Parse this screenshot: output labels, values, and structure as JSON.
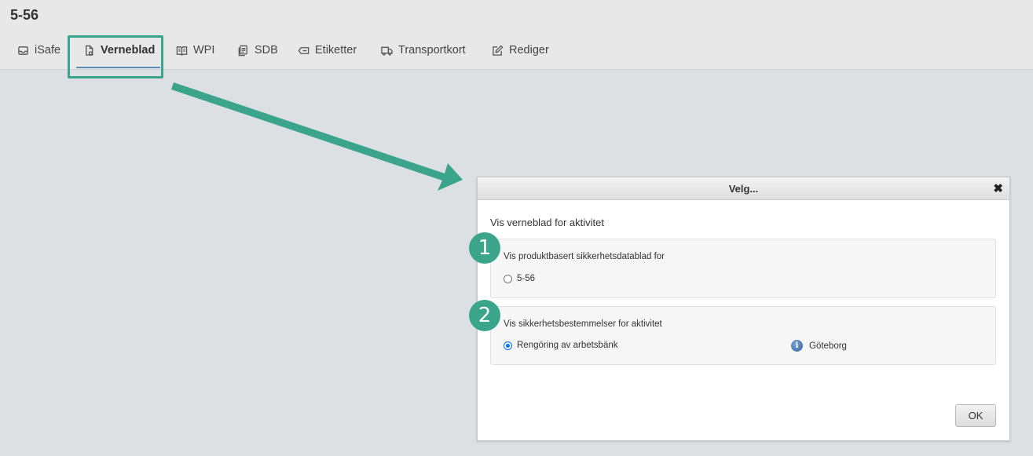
{
  "page": {
    "title": "5-56"
  },
  "tabs": [
    {
      "label": "iSafe",
      "icon": "inbox-icon",
      "active": false
    },
    {
      "label": "Verneblad",
      "icon": "document-shield-icon",
      "active": true
    },
    {
      "label": "WPI",
      "icon": "book-icon",
      "active": false
    },
    {
      "label": "SDB",
      "icon": "documents-icon",
      "active": false
    },
    {
      "label": "Etiketter",
      "icon": "label-icon",
      "active": false
    },
    {
      "label": "Transportkort",
      "icon": "truck-icon",
      "active": false
    },
    {
      "label": "Rediger",
      "icon": "edit-icon",
      "active": false
    }
  ],
  "annotations": {
    "color": "#3aa58b",
    "badge1": "1",
    "badge2": "2"
  },
  "dialog": {
    "title": "Velg...",
    "close_symbol": "✖",
    "heading": "Vis verneblad for aktivitet",
    "section1": {
      "label": "Vis produktbasert sikkerhetsdatablad for",
      "option": "5-56",
      "checked": false
    },
    "section2": {
      "label": "Vis sikkerhetsbestemmelser for aktivitet",
      "option": "Rengöring av arbetsbänk",
      "checked": true,
      "location": "Göteborg",
      "location_icon": "info-icon"
    },
    "ok_label": "OK"
  }
}
